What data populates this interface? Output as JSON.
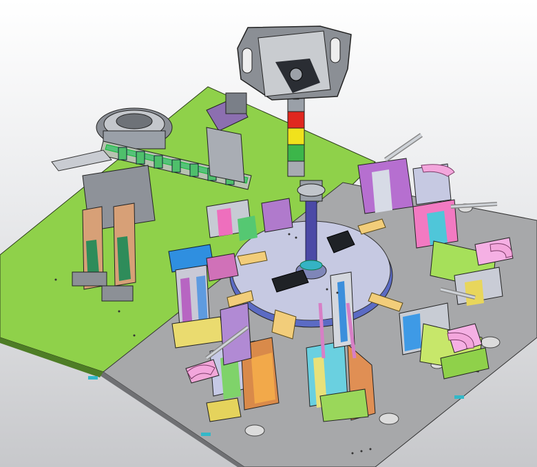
{
  "scene": {
    "colors": {
      "background_top": "#ffffff",
      "background_bottom": "#c7c8cb",
      "green_plate": "#8fd14a",
      "grey_plate": "#a7a8aa",
      "turntable": "#c6c9e2",
      "stack_red": "#e0271f",
      "stack_yellow": "#f0e21c",
      "stack_green": "#3cb64a"
    },
    "tower_light_segments": [
      "red",
      "yellow",
      "green"
    ],
    "station_count": 8
  }
}
